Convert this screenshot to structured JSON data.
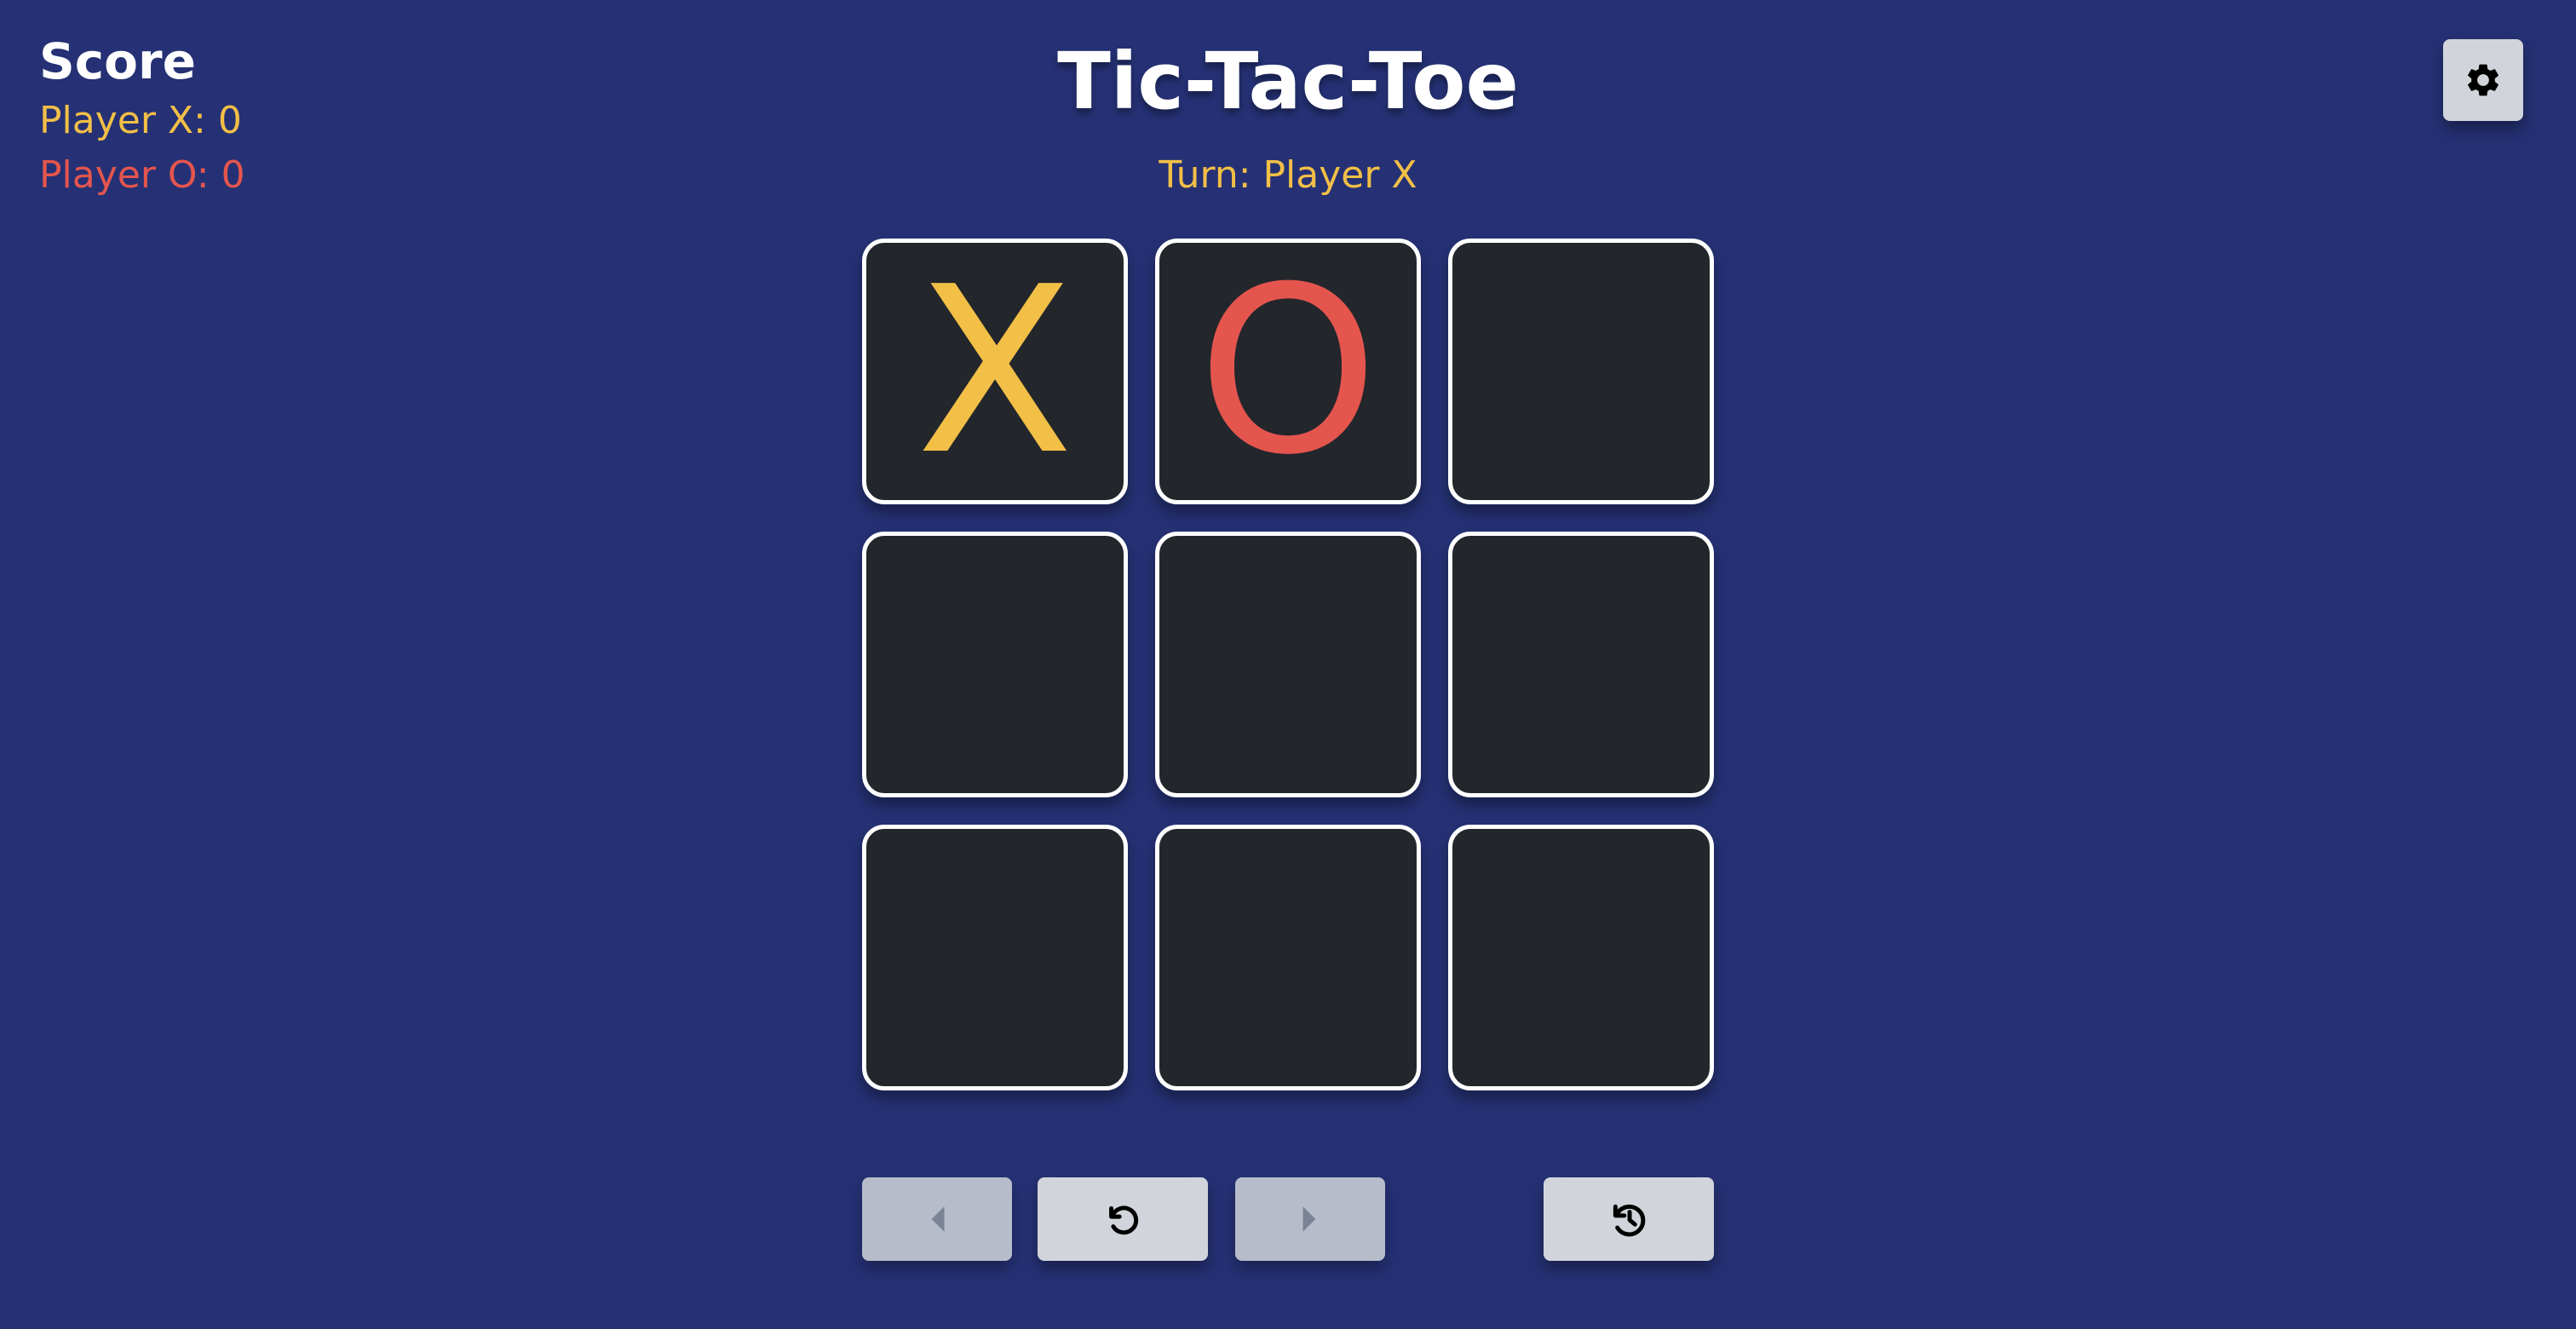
{
  "score": {
    "title": "Score",
    "player_x": "Player X: 0",
    "player_o": "Player O: 0"
  },
  "header": {
    "title": "Tic-Tac-Toe",
    "turn": "Turn: Player X"
  },
  "board": {
    "cells": [
      "X",
      "O",
      "",
      "",
      "",
      "",
      "",
      "",
      ""
    ]
  },
  "controls": {
    "previous_icon": "caret-left-icon",
    "restart_icon": "rotate-left-icon",
    "next_icon": "caret-right-icon",
    "history_icon": "clock-rotate-left-icon",
    "settings_icon": "gear-icon"
  },
  "colors": {
    "background": "#253174",
    "x": "#f2bf47",
    "o": "#e4554e",
    "cell": "#23262b",
    "button": "#d1d5db"
  }
}
